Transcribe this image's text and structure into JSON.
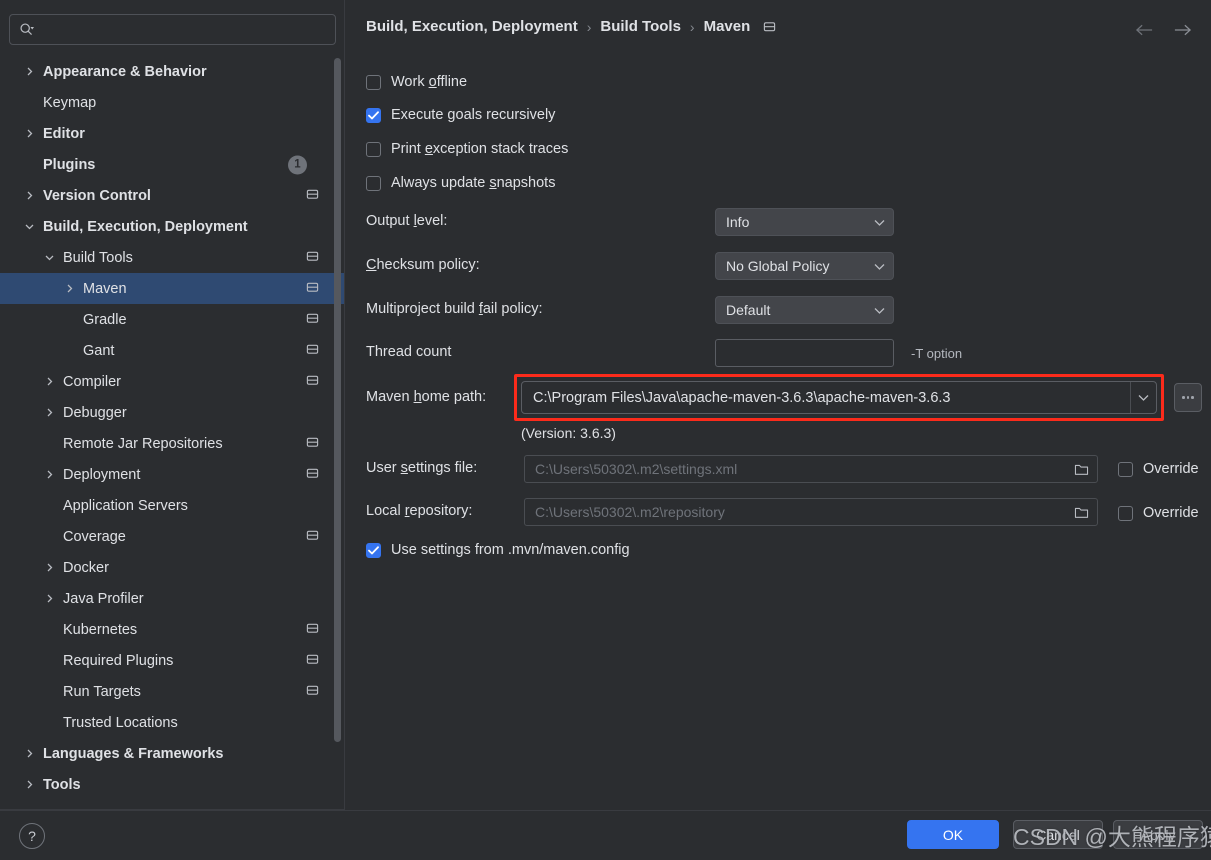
{
  "search": {
    "placeholder": "",
    "value": "",
    "icon": "search-icon"
  },
  "sidebar": {
    "items": [
      {
        "label": "Appearance & Behavior",
        "indent": 0,
        "arrow": "right",
        "bold": true,
        "icon": false,
        "badge": null
      },
      {
        "label": "Keymap",
        "indent": 0,
        "arrow": "none",
        "bold": false,
        "icon": false,
        "badge": null
      },
      {
        "label": "Editor",
        "indent": 0,
        "arrow": "right",
        "bold": true,
        "icon": false,
        "badge": null
      },
      {
        "label": "Plugins",
        "indent": 0,
        "arrow": "none",
        "bold": true,
        "icon": false,
        "badge": "1"
      },
      {
        "label": "Version Control",
        "indent": 0,
        "arrow": "right",
        "bold": true,
        "icon": true,
        "badge": null
      },
      {
        "label": "Build, Execution, Deployment",
        "indent": 0,
        "arrow": "down",
        "bold": true,
        "icon": false,
        "badge": null
      },
      {
        "label": "Build Tools",
        "indent": 1,
        "arrow": "down",
        "bold": false,
        "icon": true,
        "badge": null
      },
      {
        "label": "Maven",
        "indent": 2,
        "arrow": "right",
        "bold": false,
        "icon": true,
        "badge": null,
        "selected": true
      },
      {
        "label": "Gradle",
        "indent": 2,
        "arrow": "none",
        "bold": false,
        "icon": true,
        "badge": null
      },
      {
        "label": "Gant",
        "indent": 2,
        "arrow": "none",
        "bold": false,
        "icon": true,
        "badge": null
      },
      {
        "label": "Compiler",
        "indent": 1,
        "arrow": "right",
        "bold": false,
        "icon": true,
        "badge": null
      },
      {
        "label": "Debugger",
        "indent": 1,
        "arrow": "right",
        "bold": false,
        "icon": false,
        "badge": null
      },
      {
        "label": "Remote Jar Repositories",
        "indent": 1,
        "arrow": "none",
        "bold": false,
        "icon": true,
        "badge": null
      },
      {
        "label": "Deployment",
        "indent": 1,
        "arrow": "right",
        "bold": false,
        "icon": true,
        "badge": null
      },
      {
        "label": "Application Servers",
        "indent": 1,
        "arrow": "none",
        "bold": false,
        "icon": false,
        "badge": null
      },
      {
        "label": "Coverage",
        "indent": 1,
        "arrow": "none",
        "bold": false,
        "icon": true,
        "badge": null
      },
      {
        "label": "Docker",
        "indent": 1,
        "arrow": "right",
        "bold": false,
        "icon": false,
        "badge": null
      },
      {
        "label": "Java Profiler",
        "indent": 1,
        "arrow": "right",
        "bold": false,
        "icon": false,
        "badge": null
      },
      {
        "label": "Kubernetes",
        "indent": 1,
        "arrow": "none",
        "bold": false,
        "icon": true,
        "badge": null
      },
      {
        "label": "Required Plugins",
        "indent": 1,
        "arrow": "none",
        "bold": false,
        "icon": true,
        "badge": null
      },
      {
        "label": "Run Targets",
        "indent": 1,
        "arrow": "none",
        "bold": false,
        "icon": true,
        "badge": null
      },
      {
        "label": "Trusted Locations",
        "indent": 1,
        "arrow": "none",
        "bold": false,
        "icon": false,
        "badge": null
      },
      {
        "label": "Languages & Frameworks",
        "indent": 0,
        "arrow": "right",
        "bold": true,
        "icon": false,
        "badge": null
      },
      {
        "label": "Tools",
        "indent": 0,
        "arrow": "right",
        "bold": true,
        "icon": false,
        "badge": null
      }
    ]
  },
  "header": {
    "breadcrumb": [
      "Build, Execution, Deployment",
      "Build Tools",
      "Maven"
    ],
    "separator": "›",
    "project_icon": "project-scope-icon",
    "back_icon": "arrow-left-icon",
    "forward_icon": "arrow-right-icon"
  },
  "main": {
    "checkboxes": [
      {
        "label_pre": "Work ",
        "mnemonic": "o",
        "label_post": "ffline",
        "checked": false
      },
      {
        "label_pre": "Execute ",
        "mnemonic": "g",
        "label_post": "oals recursively",
        "checked": true
      },
      {
        "label_pre": "Print ",
        "mnemonic": "e",
        "label_post": "xception stack traces",
        "checked": false
      },
      {
        "label_pre": "Always update ",
        "mnemonic": "s",
        "label_post": "napshots",
        "checked": false
      }
    ],
    "output_level": {
      "label_pre": "Output ",
      "mnemonic": "l",
      "label_post": "evel:",
      "value": "Info"
    },
    "checksum_policy": {
      "label_pre": "",
      "mnemonic": "C",
      "label_post": "hecksum policy:",
      "value": "No Global Policy"
    },
    "fail_policy": {
      "label_pre": "Multiproject build ",
      "mnemonic": "f",
      "label_post": "ail policy:",
      "value": "Default"
    },
    "thread_count": {
      "label": "Thread count",
      "value": "",
      "hint": "-T option"
    },
    "maven_home": {
      "label_pre": "Maven ",
      "mnemonic": "h",
      "label_post": "ome path:",
      "value": "C:\\Program Files\\Java\\apache-maven-3.6.3\\apache-maven-3.6.3",
      "version_note": "(Version: 3.6.3)",
      "browse_label": "browse-ellipsis",
      "highlight_color": "#fc2b1b"
    },
    "user_settings": {
      "label_pre": "User ",
      "mnemonic": "s",
      "label_post": "ettings file:",
      "placeholder": "C:\\Users\\50302\\.m2\\settings.xml",
      "value": "",
      "override_label": "Override",
      "override_checked": false
    },
    "local_repository": {
      "label_pre": "Local ",
      "mnemonic": "r",
      "label_post": "epository:",
      "placeholder": "C:\\Users\\50302\\.m2\\repository",
      "value": "",
      "override_label": "Override",
      "override_checked": false
    },
    "mvn_config": {
      "label": "Use settings from .mvn/maven.config",
      "checked": true
    }
  },
  "footer": {
    "help_label": "?",
    "ok_label": "OK",
    "cancel_label": "Cancel",
    "apply_label": "Apply",
    "watermark": "CSDN @大熊程序猿"
  },
  "colors": {
    "accent": "#3574f0",
    "selection": "#2f4a72",
    "background": "#2b2d30",
    "alert": "#fc2b1b"
  }
}
